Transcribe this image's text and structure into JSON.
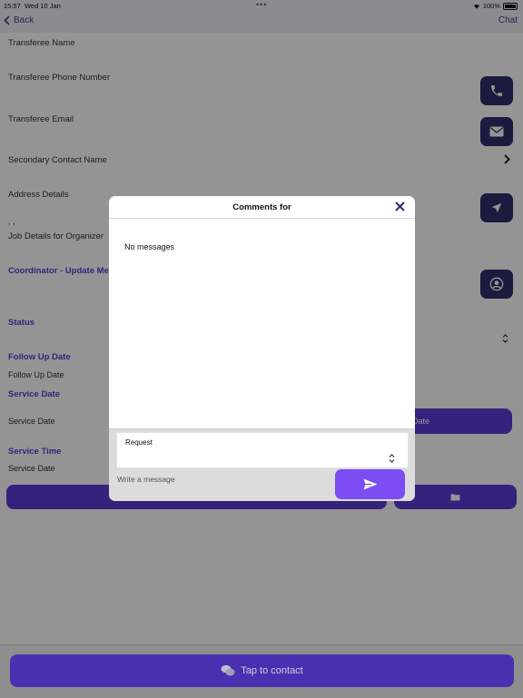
{
  "status_bar": {
    "time": "15:57",
    "date": "Wed 10 Jan",
    "battery": "100%"
  },
  "nav": {
    "back_label": "Back",
    "right_label": "Chat"
  },
  "form": {
    "transferee_name": "Transferee Name",
    "transferee_phone": "Transferee Phone Number",
    "transferee_email": "Transferee Email",
    "secondary_contact": "Secondary Contact Name",
    "address_details": "Address Details",
    "address_value": ", ,",
    "job_details": "Job Details for Organizer",
    "coordinator": "Coordinator - Update Me",
    "status": "Status",
    "follow_up_title": "Follow Up Date",
    "follow_up_value": "Follow Up Date",
    "service_date_title": "Service Date",
    "service_date_value": "Service Date",
    "service_date_button_tail": "Date",
    "service_time_title": "Service Time",
    "service_time_value": "Service Date"
  },
  "modal": {
    "title": "Comments for",
    "empty_text": "No messages",
    "request_label": "Request",
    "message_placeholder": "Write a message"
  },
  "bottom": {
    "contact_label": "Tap to contact"
  },
  "colors": {
    "accent": "#5b3cd6",
    "icon_button": "#2d2f6b",
    "send": "#7b4df2"
  },
  "icons": [
    "chevron-left-icon",
    "phone-icon",
    "mail-icon",
    "chevron-right-icon",
    "navigation-arrow-icon",
    "user-circle-icon",
    "updown-chevron-icon",
    "folder-icon",
    "close-icon",
    "send-icon",
    "chat-bubbles-icon"
  ]
}
